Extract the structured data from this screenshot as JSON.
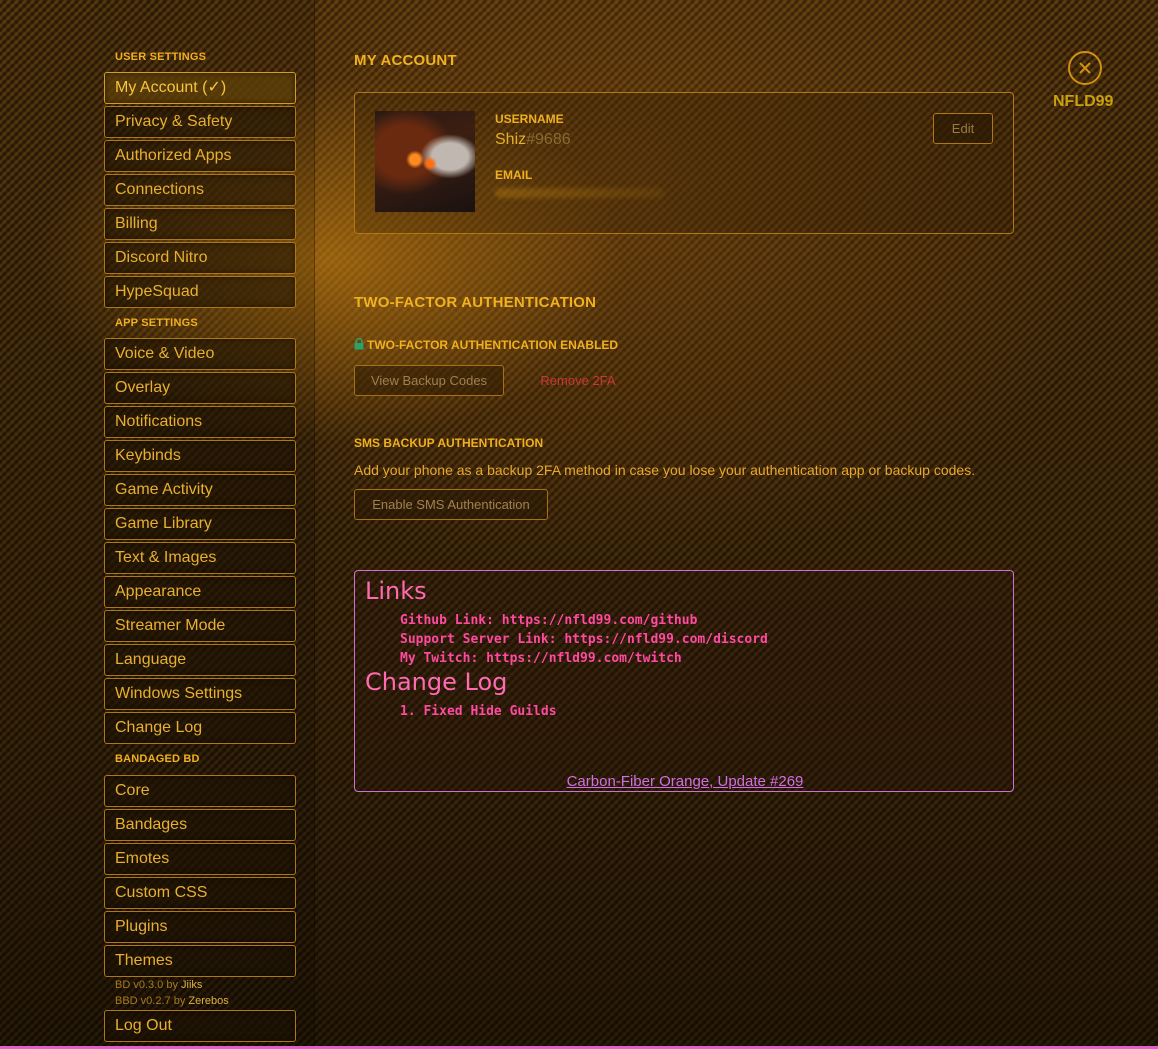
{
  "sidebar": {
    "user_settings_header": "USER SETTINGS",
    "user_settings": [
      {
        "label": "My Account (✓)"
      },
      {
        "label": "Privacy & Safety"
      },
      {
        "label": "Authorized Apps"
      },
      {
        "label": "Connections"
      },
      {
        "label": "Billing"
      },
      {
        "label": "Discord Nitro"
      },
      {
        "label": "HypeSquad"
      }
    ],
    "app_settings_header": "APP SETTINGS",
    "app_settings": [
      {
        "label": "Voice & Video"
      },
      {
        "label": "Overlay"
      },
      {
        "label": "Notifications"
      },
      {
        "label": "Keybinds"
      },
      {
        "label": "Game Activity"
      },
      {
        "label": "Game Library"
      },
      {
        "label": "Text & Images"
      },
      {
        "label": "Appearance"
      },
      {
        "label": "Streamer Mode"
      },
      {
        "label": "Language"
      },
      {
        "label": "Windows Settings"
      },
      {
        "label": "Change Log"
      }
    ],
    "bandaged_header": "BANDAGED BD",
    "bandaged": [
      {
        "label": "Core"
      },
      {
        "label": "Bandages"
      },
      {
        "label": "Emotes"
      },
      {
        "label": "Custom CSS"
      },
      {
        "label": "Plugins"
      },
      {
        "label": "Themes"
      }
    ],
    "version_bd": {
      "prefix": "BD v0.3.0 by ",
      "author": "Jiiks"
    },
    "version_bbd": {
      "prefix": "BBD v0.2.7 by ",
      "author": "Zerebos"
    },
    "logout_label": "Log Out"
  },
  "account": {
    "title": "MY ACCOUNT",
    "username_label": "USERNAME",
    "username": "Shiz",
    "discriminator": "#9686",
    "email_label": "EMAIL",
    "edit_label": "Edit"
  },
  "tfa": {
    "title": "TWO-FACTOR AUTHENTICATION",
    "enabled_label": "TWO-FACTOR AUTHENTICATION ENABLED",
    "view_codes_label": "View Backup Codes",
    "remove_label": "Remove 2FA"
  },
  "sms": {
    "title": "SMS BACKUP AUTHENTICATION",
    "description": "Add your phone as a backup 2FA method in case you lose your authentication app or backup codes.",
    "enable_label": "Enable SMS Authentication"
  },
  "info_box": {
    "links_title": "Links",
    "links": [
      "Github Link: https://nfld99.com/github",
      "Support Server Link: https://nfld99.com/discord",
      "My Twitch: https://nfld99.com/twitch"
    ],
    "changelog_title": "Change Log",
    "changelog": [
      "1. Fixed Hide Guilds"
    ],
    "footer": "Carbon-Fiber Orange, Update #269"
  },
  "close": {
    "label": "NFLD99",
    "icon": "close-icon"
  },
  "colors": {
    "accent": "#f0b020",
    "pink": "#ff6ab0",
    "danger": "#c83838",
    "lock": "#2aa36a"
  }
}
